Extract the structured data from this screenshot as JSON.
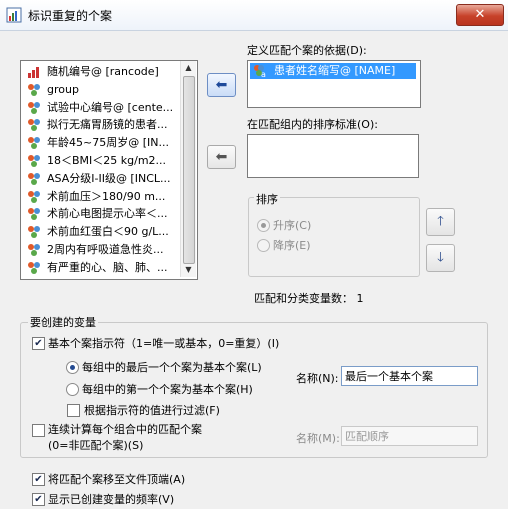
{
  "window": {
    "title": "标识重复的个案",
    "close_label": "✕"
  },
  "variable_list": {
    "items": [
      {
        "label": "随机编号@ [rancode]",
        "icon": "scale-icon"
      },
      {
        "label": "group",
        "icon": "nominal-icon"
      },
      {
        "label": "试验中心编号@ [cente...",
        "icon": "nominal-icon"
      },
      {
        "label": "拟行无痛胃肠镜的患者...",
        "icon": "nominal-icon"
      },
      {
        "label": "年龄45~75周岁@ [IN...",
        "icon": "nominal-icon"
      },
      {
        "label": "18＜BMI＜25 kg/m2...",
        "icon": "nominal-icon"
      },
      {
        "label": "ASA分级I-II级@ [INCL...",
        "icon": "nominal-icon"
      },
      {
        "label": "术前血压＞180/90 m...",
        "icon": "nominal-icon"
      },
      {
        "label": "术前心电图提示心率＜...",
        "icon": "nominal-icon"
      },
      {
        "label": "术前血红蛋白＜90 g/L...",
        "icon": "nominal-icon"
      },
      {
        "label": "2周内有呼吸道急性炎...",
        "icon": "nominal-icon"
      },
      {
        "label": "有严重的心、脑、肺、...",
        "icon": "nominal-icon"
      }
    ]
  },
  "match": {
    "label": "定义匹配个案的依据(D):",
    "item": "患者姓名缩写@ [NAME]"
  },
  "sort": {
    "label": "在匹配组内的排序标准(O):"
  },
  "sort_order": {
    "title": "排序",
    "ascending": "升序(C)",
    "descending": "降序(E)"
  },
  "count": {
    "text": "匹配和分类变量数：  1"
  },
  "create": {
    "title": "要创建的变量",
    "primary_indicator": "基本个案指示符（1=唯一或基本，0=重复）(I)",
    "last_case": "每组中的最后一个个案为基本个案(L)",
    "first_case": "每组中的第一个个案为基本个案(H)",
    "filter": "根据指示符的值进行过滤(F)",
    "name_label_1": "名称(N):",
    "name_value_1": "最后一个基本个案",
    "count_seq": "连续计算每个组合中的匹配个案",
    "count_seq_2": "(0=非匹配个案)(S)",
    "name_label_2": "名称(M):",
    "name_value_2": "匹配顺序"
  },
  "options": {
    "move_top": "将匹配个案移至文件顶端(A)",
    "show_freq": "显示已创建变量的频率(V)"
  },
  "colors": {
    "selection": "#3399ff",
    "close": "#c7422a"
  }
}
